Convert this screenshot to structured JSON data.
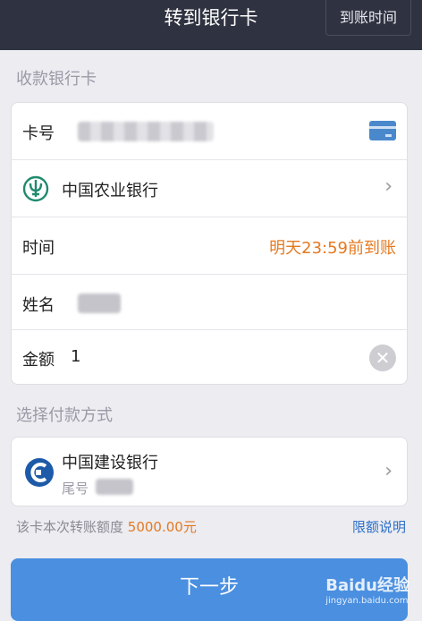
{
  "header": {
    "title": "转到银行卡",
    "arrival_time_button": "到账时间"
  },
  "receiver_section": {
    "label": "收款银行卡",
    "card_number_label": "卡号",
    "bank_name": "中国农业银行",
    "time_label": "时间",
    "time_value": "明天23:59前到账",
    "name_label": "姓名",
    "amount_label": "金额",
    "amount_value": "1"
  },
  "payment_section": {
    "label": "选择付款方式",
    "bank_name": "中国建设银行",
    "tail_label": "尾号"
  },
  "limit": {
    "prefix": "该卡本次转账额度",
    "amount": "5000.00元",
    "link": "限额说明"
  },
  "next_button": "下一步",
  "watermark": {
    "logo": "Baidu经验",
    "url": "jingyan.baidu.com"
  },
  "colors": {
    "header_bg": "#2f3240",
    "accent_orange": "#e5791f",
    "link_blue": "#2b6fc7",
    "button_blue": "#4a8fe0"
  }
}
